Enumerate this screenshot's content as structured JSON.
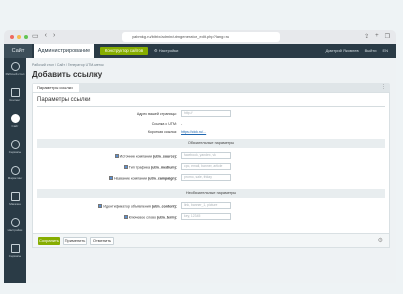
{
  "browser": {
    "url": "yabmkg.ru/bitrix/admin/utmgenerator_edit.php?lang=ru",
    "colors": {
      "red": "#ee6a5f",
      "yellow": "#f5be4f",
      "green": "#62c554"
    }
  },
  "header": {
    "site_label": "Сайт",
    "admin_label": "Администрирование",
    "constructor_button": "Конструктор сайтов",
    "notifications_label": "Настройки",
    "user_label": "Дмитрий Яковлев",
    "exit_label": "Выйти",
    "lang_label": "EN"
  },
  "sidebar": {
    "items": [
      {
        "label": "Рабочий стол",
        "icon": "desktop-icon"
      },
      {
        "label": "Контент",
        "icon": "content-icon"
      },
      {
        "label": "Сайт",
        "icon": "site-icon"
      },
      {
        "label": "Сервисы",
        "icon": "services-icon"
      },
      {
        "label": "Маркетинг",
        "icon": "marketing-icon"
      },
      {
        "label": "Магазин",
        "icon": "store-icon"
      },
      {
        "label": "Настройки",
        "icon": "settings-icon"
      },
      {
        "label": "Сервисы",
        "icon": "more-icon"
      }
    ]
  },
  "main": {
    "breadcrumb": "Рабочий стол  /  Сайт  /  Генератор UTM-меток",
    "title": "Добавить ссылку",
    "tab": "Параметры ссылки",
    "panel_title": "Параметры ссылки",
    "fields": {
      "page_address": {
        "label": "Адрес вашей страницы:",
        "placeholder": "http://"
      },
      "link_with_utm": {
        "label": "Ссылка с UTM:",
        "value": "-"
      },
      "short_link": {
        "label": "Короткая ссылка:",
        "value": "https://clck.ru/..."
      }
    },
    "required_section": "Обязательные параметры",
    "required": [
      {
        "label": "Источник компании",
        "param": "(utm_source):",
        "placeholder": "facebook, yandex, vk"
      },
      {
        "label": "Тип трафика",
        "param": "(utm_medium):",
        "placeholder": "cpc, email, banner, article"
      },
      {
        "label": "Название компании",
        "param": "(utm_campaign):",
        "placeholder": "promo, sale, friday"
      }
    ],
    "optional_section": "Необязательные параметры",
    "optional": [
      {
        "label": "Идентификатор объявления",
        "param": "(utm_content):",
        "placeholder": "link, banner_1, picture"
      },
      {
        "label": "Ключевое слово",
        "param": "(utm_term):",
        "placeholder": "key, 12345"
      }
    ],
    "buttons": {
      "save": "Сохранить",
      "apply": "Применить",
      "cancel": "Отменить"
    }
  }
}
